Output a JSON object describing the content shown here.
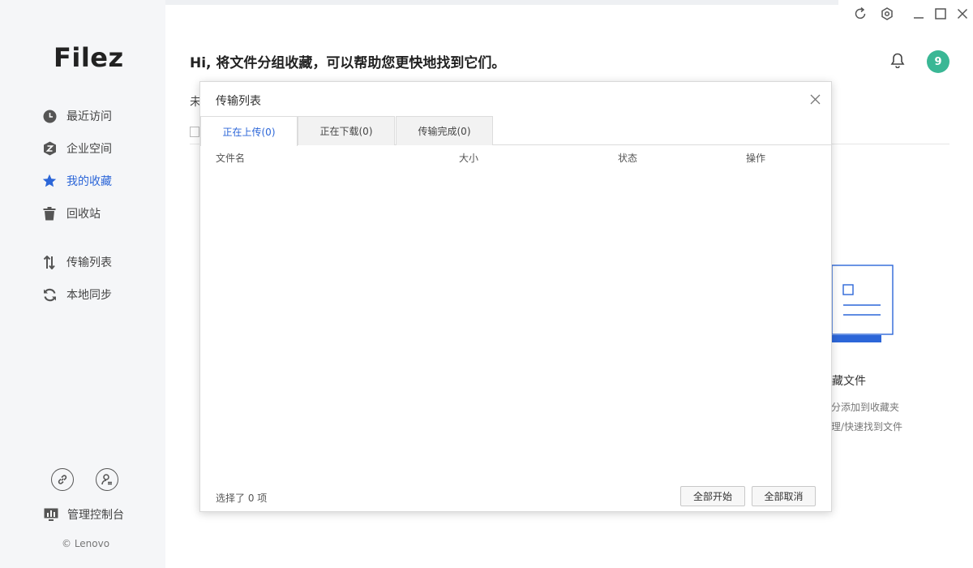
{
  "app": {
    "logo": "Filez",
    "copyright": "© Lenovo"
  },
  "sidebar": {
    "items": [
      {
        "label": "最近访问",
        "icon": "clock-icon"
      },
      {
        "label": "企业空间",
        "icon": "enterprise-icon"
      },
      {
        "label": "我的收藏",
        "icon": "star-icon",
        "active": true
      },
      {
        "label": "回收站",
        "icon": "trash-icon"
      },
      {
        "label": "传输列表",
        "icon": "transfer-icon"
      },
      {
        "label": "本地同步",
        "icon": "sync-icon"
      }
    ],
    "admin_label": "管理控制台"
  },
  "header": {
    "greeting": "Hi, 将文件分组收藏，可以帮助您更快地找到它们。",
    "avatar_text": "9"
  },
  "background": {
    "tab_partial": "未",
    "empty_title": "藏文件",
    "empty_line1": "分添加到收藏夹",
    "empty_line2": "理/快速找到文件"
  },
  "dialog": {
    "title": "传输列表",
    "tabs": [
      {
        "label": "正在上传(0)",
        "active": true
      },
      {
        "label": "正在下载(0)"
      },
      {
        "label": "传输完成(0)"
      }
    ],
    "columns": [
      "文件名",
      "大小",
      "状态",
      "操作"
    ],
    "selected_text": "选择了 0 项",
    "start_all": "全部开始",
    "cancel_all": "全部取消"
  },
  "colors": {
    "accent": "#2c66d8",
    "avatar": "#3ab795",
    "sidebar_bg": "#f5f6f8"
  }
}
